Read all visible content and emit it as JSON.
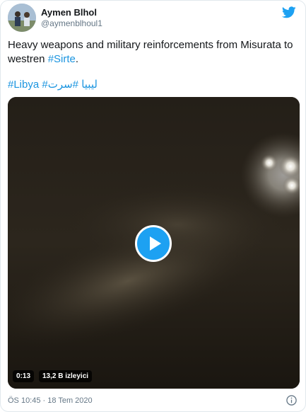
{
  "author": {
    "name": "Aymen Blhol",
    "handle": "@aymenblhoul1"
  },
  "tweet": {
    "text_main": "Heavy weapons and military reinforcements from Misurata to westren ",
    "text_hashtag": "#Sirte",
    "text_end": ".",
    "hashtags_line": "#Libya #ليبيا #سرت"
  },
  "video": {
    "duration": "0:13",
    "views": "13,2 B izleyici"
  },
  "timestamp": "ÖS 10:45 · 18 Tem 2020",
  "colors": {
    "accent": "#1da1f2",
    "link": "#1b95e0",
    "muted": "#657786"
  },
  "icons": {
    "brand": "twitter-bird-icon",
    "play": "play-icon",
    "info": "info-icon"
  }
}
